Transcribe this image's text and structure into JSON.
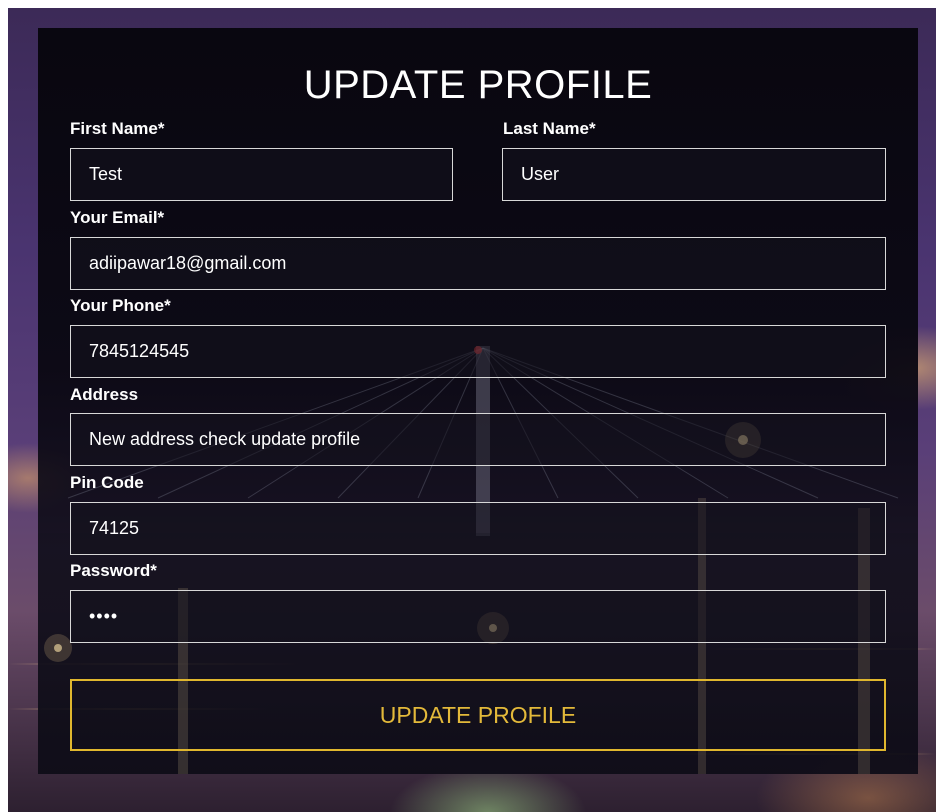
{
  "form": {
    "title": "UPDATE PROFILE",
    "first_name": {
      "label": "First Name*",
      "value": "Test"
    },
    "last_name": {
      "label": "Last Name*",
      "value": "User"
    },
    "email": {
      "label": "Your Email*",
      "value": "adiipawar18@gmail.com"
    },
    "phone": {
      "label": "Your Phone*",
      "value": "7845124545"
    },
    "address": {
      "label": "Address",
      "value": "New address check update profile"
    },
    "pin_code": {
      "label": "Pin Code",
      "value": "74125"
    },
    "password": {
      "label": "Password*",
      "value": "••••"
    },
    "submit_label": "UPDATE PROFILE"
  },
  "colors": {
    "panel_background": "#0a0812",
    "text": "#ffffff",
    "field_border": "#d8d8d8",
    "accent": "#e0b72e"
  }
}
